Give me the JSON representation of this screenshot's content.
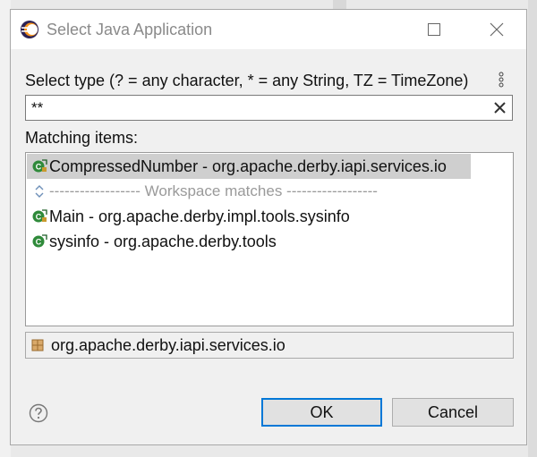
{
  "window": {
    "title": "Select Java Application",
    "minimize_label": "",
    "close_label": ""
  },
  "filter": {
    "label": "Select type (? = any character, * = any String, TZ = TimeZone)",
    "value": "**"
  },
  "matching": {
    "label": "Matching items:",
    "items": [
      {
        "text": "CompressedNumber - org.apache.derby.iapi.services.io",
        "selected": true,
        "icon": "java-class-main-icon"
      },
      {
        "text": "------------------ Workspace matches ------------------",
        "separator": true,
        "icon": "expand-collapse-icon"
      },
      {
        "text": "Main - org.apache.derby.impl.tools.sysinfo",
        "icon": "java-class-main-icon"
      },
      {
        "text": "sysinfo - org.apache.derby.tools",
        "icon": "java-class-main-icon"
      }
    ]
  },
  "status": {
    "text": "org.apache.derby.iapi.services.io",
    "icon": "package-icon"
  },
  "buttons": {
    "ok": "OK",
    "cancel": "Cancel"
  },
  "colors": {
    "accent": "#0078d7",
    "selection": "#cfcfcf",
    "class_icon_green": "#2f8a3a"
  }
}
